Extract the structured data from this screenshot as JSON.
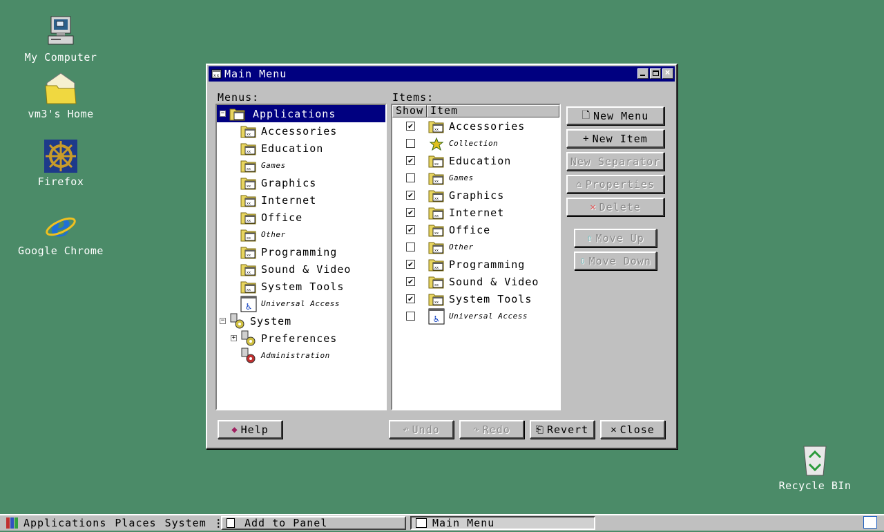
{
  "desktop": {
    "icons": [
      {
        "label": "My Computer",
        "icon": "computer-icon"
      },
      {
        "label": "vm3's Home",
        "icon": "home-folder-icon"
      },
      {
        "label": "Firefox",
        "icon": "firefox-icon"
      },
      {
        "label": "Google Chrome",
        "icon": "ie-icon"
      },
      {
        "label": "Recycle BIn",
        "icon": "recycle-bin-icon"
      }
    ]
  },
  "window": {
    "title": "Main Menu",
    "menus_label": "Menus:",
    "items_label": "Items:",
    "tree": [
      {
        "label": "Applications",
        "expander": "⊟"
      },
      {
        "label": "Accessories"
      },
      {
        "label": "Education"
      },
      {
        "label": "Games"
      },
      {
        "label": "Graphics"
      },
      {
        "label": "Internet"
      },
      {
        "label": "Office"
      },
      {
        "label": "Other"
      },
      {
        "label": "Programming"
      },
      {
        "label": "Sound & Video"
      },
      {
        "label": "System Tools"
      },
      {
        "label": "Universal Access"
      },
      {
        "label": "System",
        "expander": "⊟"
      },
      {
        "label": "Preferences",
        "expander": "⊞"
      },
      {
        "label": "Administration"
      }
    ],
    "list_headers": {
      "show": "Show",
      "item": "Item"
    },
    "items": [
      {
        "label": "Accessories",
        "checked": "✔"
      },
      {
        "label": "Collection",
        "checked": ""
      },
      {
        "label": "Education",
        "checked": "✔"
      },
      {
        "label": "Games",
        "checked": ""
      },
      {
        "label": "Graphics",
        "checked": "✔"
      },
      {
        "label": "Internet",
        "checked": "✔"
      },
      {
        "label": "Office",
        "checked": "✔"
      },
      {
        "label": "Other",
        "checked": ""
      },
      {
        "label": "Programming",
        "checked": "✔"
      },
      {
        "label": "Sound & Video",
        "checked": "✔"
      },
      {
        "label": "System Tools",
        "checked": "✔"
      },
      {
        "label": "Universal Access",
        "checked": ""
      }
    ],
    "buttons": {
      "new_menu": "New Menu",
      "new_item": "New Item",
      "new_separator": "New Separator",
      "properties": "Properties",
      "delete": "Delete",
      "move_up": "Move Up",
      "move_down": "Move Down",
      "help": "Help",
      "undo": "Undo",
      "redo": "Redo",
      "revert": "Revert",
      "close": "Close"
    }
  },
  "taskbar": {
    "menus": [
      "Applications",
      "Places",
      "System"
    ],
    "tasks": [
      "Add to Panel",
      "Main Menu"
    ]
  },
  "colors": {
    "desktop": "#4b8b68",
    "titlebar": "#000080",
    "face": "#c0c0c0"
  }
}
